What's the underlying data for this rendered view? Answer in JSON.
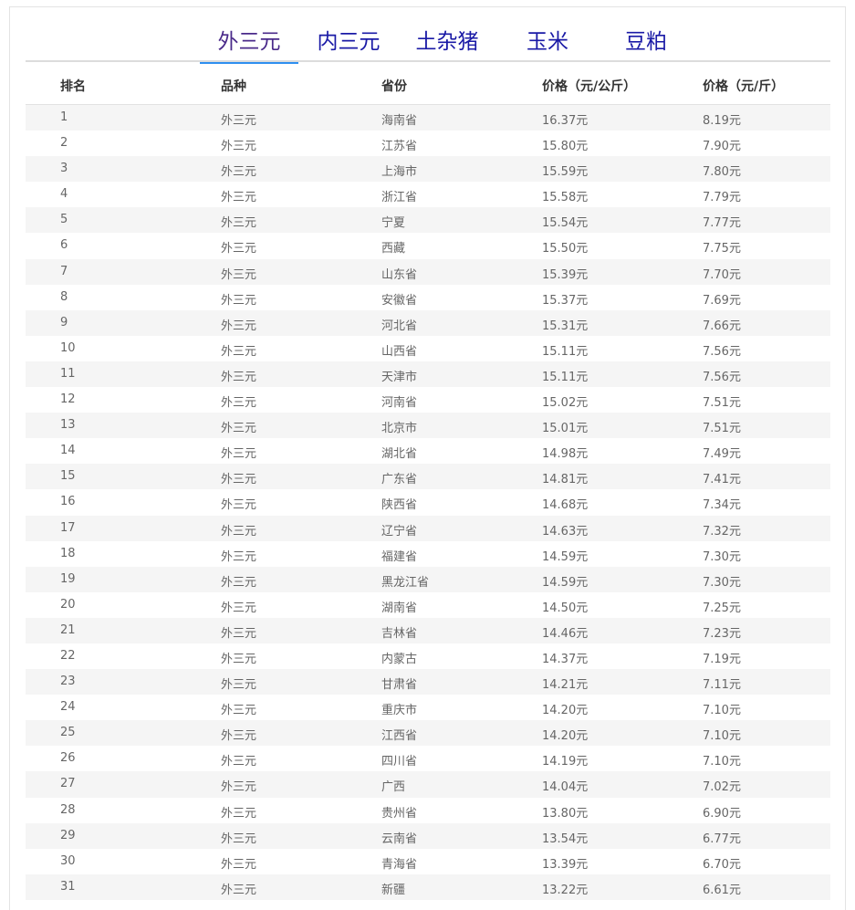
{
  "tabs": [
    "外三元",
    "内三元",
    "土杂猪",
    "玉米",
    "豆粕"
  ],
  "active_tab": 0,
  "columns": [
    "排名",
    "品种",
    "省份",
    "价格（元/公斤）",
    "价格（元/斤）"
  ],
  "rows": [
    [
      "1",
      "外三元",
      "海南省",
      "16.37元",
      "8.19元"
    ],
    [
      "2",
      "外三元",
      "江苏省",
      "15.80元",
      "7.90元"
    ],
    [
      "3",
      "外三元",
      "上海市",
      "15.59元",
      "7.80元"
    ],
    [
      "4",
      "外三元",
      "浙江省",
      "15.58元",
      "7.79元"
    ],
    [
      "5",
      "外三元",
      "宁夏",
      "15.54元",
      "7.77元"
    ],
    [
      "6",
      "外三元",
      "西藏",
      "15.50元",
      "7.75元"
    ],
    [
      "7",
      "外三元",
      "山东省",
      "15.39元",
      "7.70元"
    ],
    [
      "8",
      "外三元",
      "安徽省",
      "15.37元",
      "7.69元"
    ],
    [
      "9",
      "外三元",
      "河北省",
      "15.31元",
      "7.66元"
    ],
    [
      "10",
      "外三元",
      "山西省",
      "15.11元",
      "7.56元"
    ],
    [
      "11",
      "外三元",
      "天津市",
      "15.11元",
      "7.56元"
    ],
    [
      "12",
      "外三元",
      "河南省",
      "15.02元",
      "7.51元"
    ],
    [
      "13",
      "外三元",
      "北京市",
      "15.01元",
      "7.51元"
    ],
    [
      "14",
      "外三元",
      "湖北省",
      "14.98元",
      "7.49元"
    ],
    [
      "15",
      "外三元",
      "广东省",
      "14.81元",
      "7.41元"
    ],
    [
      "16",
      "外三元",
      "陕西省",
      "14.68元",
      "7.34元"
    ],
    [
      "17",
      "外三元",
      "辽宁省",
      "14.63元",
      "7.32元"
    ],
    [
      "18",
      "外三元",
      "福建省",
      "14.59元",
      "7.30元"
    ],
    [
      "19",
      "外三元",
      "黑龙江省",
      "14.59元",
      "7.30元"
    ],
    [
      "20",
      "外三元",
      "湖南省",
      "14.50元",
      "7.25元"
    ],
    [
      "21",
      "外三元",
      "吉林省",
      "14.46元",
      "7.23元"
    ],
    [
      "22",
      "外三元",
      "内蒙古",
      "14.37元",
      "7.19元"
    ],
    [
      "23",
      "外三元",
      "甘肃省",
      "14.21元",
      "7.11元"
    ],
    [
      "24",
      "外三元",
      "重庆市",
      "14.20元",
      "7.10元"
    ],
    [
      "25",
      "外三元",
      "江西省",
      "14.20元",
      "7.10元"
    ],
    [
      "26",
      "外三元",
      "四川省",
      "14.19元",
      "7.10元"
    ],
    [
      "27",
      "外三元",
      "广西",
      "14.04元",
      "7.02元"
    ],
    [
      "28",
      "外三元",
      "贵州省",
      "13.80元",
      "6.90元"
    ],
    [
      "29",
      "外三元",
      "云南省",
      "13.54元",
      "6.77元"
    ],
    [
      "30",
      "外三元",
      "青海省",
      "13.39元",
      "6.70元"
    ],
    [
      "31",
      "外三元",
      "新疆",
      "13.22元",
      "6.61元"
    ]
  ]
}
